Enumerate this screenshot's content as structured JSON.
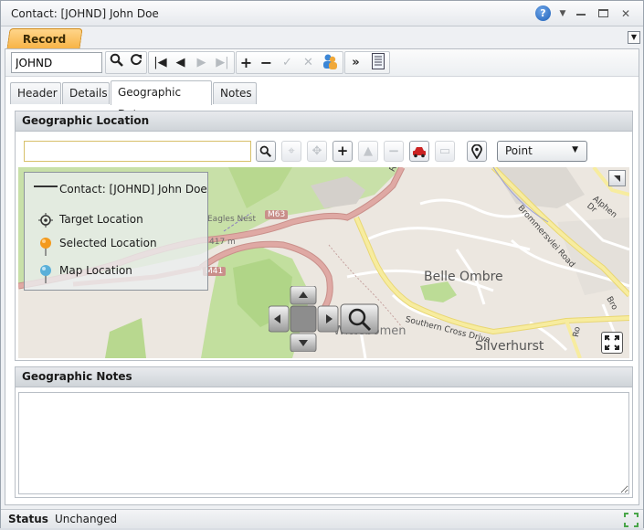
{
  "window": {
    "title": "Contact: [JOHND] John Doe"
  },
  "ribbon": {
    "record_tab": "Record"
  },
  "toolbar": {
    "search_value": "JOHND"
  },
  "tabs": [
    {
      "label": "Header"
    },
    {
      "label": "Details"
    },
    {
      "label": "Geographic Data"
    },
    {
      "label": "Notes"
    }
  ],
  "geo_location": {
    "heading": "Geographic Location",
    "search_value": "",
    "mode_select": "Point",
    "legend": {
      "contact": "Contact: [JOHND] John Doe",
      "target": "Target Location",
      "selected": "Selected Location",
      "map": "Map Location"
    },
    "map_labels": {
      "belle_ombre": "Belle Ombre",
      "silverhurst": "Silverhurst",
      "wittebomen": "Wittebomen",
      "southern_cross": "Southern Cross Drive",
      "brommersvlei": "Brommersvlei Road",
      "alphen": "Alphen Dr",
      "m63": "M63",
      "m41": "M41",
      "eagles_nest": "Eagles Nest",
      "elevation": "417 m",
      "rh": "Rh",
      "bro": "Bro",
      "ro": "Ro"
    }
  },
  "geo_notes": {
    "heading": "Geographic Notes",
    "text": ""
  },
  "status": {
    "label": "Status",
    "value": "Unchanged"
  },
  "colors": {
    "accent_tab": "#f7b243",
    "road_major": "#f5e58f",
    "road_m": "#d9a7a3",
    "park": "#c8e0a8"
  }
}
